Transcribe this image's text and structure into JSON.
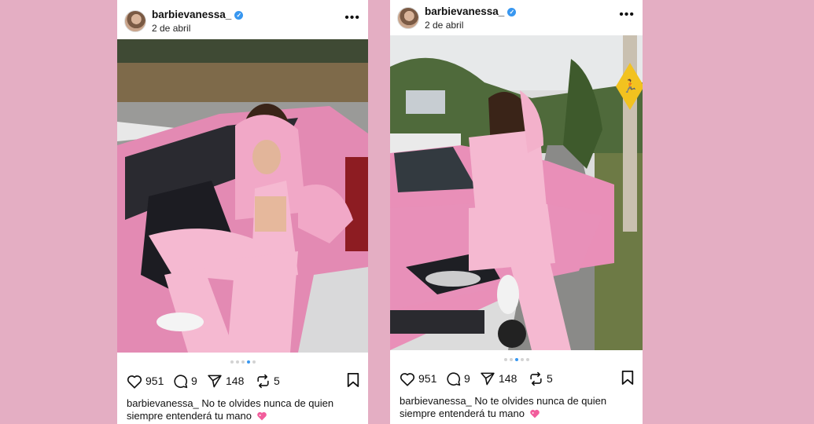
{
  "posts": [
    {
      "username": "barbievanessa_",
      "date": "2 de abril",
      "likes": "951",
      "comments": "9",
      "shares": "148",
      "reposts": "5",
      "caption_user": "barbievanessa_",
      "caption_text": "No te olvides nunca de quien siempre entenderá tu mano",
      "carousel_active_index": 4,
      "carousel_count": 5
    },
    {
      "username": "barbievanessa_",
      "date": "2 de abril",
      "likes": "951",
      "comments": "9",
      "shares": "148",
      "reposts": "5",
      "caption_user": "barbievanessa_",
      "caption_text": "No te olvides nunca de quien siempre entenderá tu mano",
      "carousel_active_index": 3,
      "carousel_count": 5
    }
  ],
  "icons": {
    "verified": "verified-badge-icon",
    "more": "more-options-icon",
    "like": "heart-icon",
    "comment": "comment-icon",
    "share": "send-icon",
    "repost": "repost-icon",
    "save": "bookmark-icon",
    "emoji": "sparkling-heart-emoji"
  },
  "colors": {
    "background": "#e4aec3",
    "verified": "#3897f0",
    "active_dot": "#3897f0",
    "car_pink": "#e98fb8",
    "outfit_pink": "#f3b6cf"
  }
}
